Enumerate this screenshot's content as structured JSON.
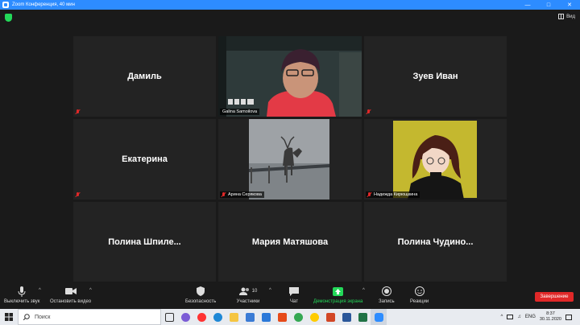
{
  "window": {
    "title": "Zoom Конференция, 40 мин"
  },
  "top": {
    "view_label": "Вид"
  },
  "participants": [
    {
      "name": "Дамиль",
      "video": false
    },
    {
      "name": "Galina Samoilova",
      "video": true
    },
    {
      "name": "Зуев Иван",
      "video": false
    },
    {
      "name": "Екатерина",
      "video": false
    },
    {
      "name": "Арина Серякова",
      "video": true
    },
    {
      "name": "Надежда Кирющкина",
      "video": true,
      "active_speaker": true
    },
    {
      "name": "Полина  Шпиле...",
      "video": false
    },
    {
      "name": "Мария Матяшова",
      "video": false
    },
    {
      "name": "Полина  Чудино...",
      "video": false
    }
  ],
  "toolbar": {
    "mute_label": "Выключить звук",
    "video_label": "Остановить видео",
    "security_label": "Безопасность",
    "participants_label": "Участники",
    "participants_count": "10",
    "chat_label": "Чат",
    "share_label": "Демонстрация экрана",
    "record_label": "Запись",
    "reactions_label": "Реакции",
    "end_label": "Завершение"
  },
  "taskbar": {
    "search_placeholder": "Поиск",
    "language": "ENG",
    "time": "8:37",
    "date": "30.11.2020"
  },
  "colors": {
    "accent": "#2d8cff",
    "active_border": "#e7ea5a",
    "end_button": "#e02828",
    "share_icon": "#23d959"
  }
}
